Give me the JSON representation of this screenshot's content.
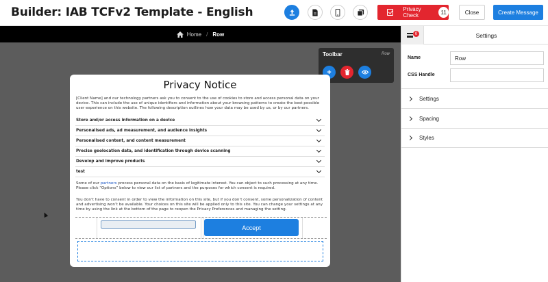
{
  "header": {
    "title": "Builder: IAB TCFv2 Template - English",
    "privacy_check_label": "Privacy Check",
    "privacy_check_count": "11",
    "close_label": "Close",
    "create_label": "Create Message"
  },
  "breadcrumb": {
    "home": "Home",
    "separator": "/",
    "current": "Row"
  },
  "toolbar": {
    "title": "Toolbar",
    "context": "Row"
  },
  "notice": {
    "title": "Privacy Notice",
    "intro": "[Client Name] and our technology partners ask you to consent to the use of cookies to store and access personal data on your device. This can include the use of unique identifiers and information about your browsing patterns to create the best possible user experience on this website. The following description outlines how your data may be used by us, or by our partners.",
    "purposes": [
      "Store and/or access information on a device",
      "Personalised ads, ad measurement, and audience insights",
      "Personalised content, and content measurement",
      "Precise geolocation data, and identification through device scanning",
      "Develop and improve products",
      "test"
    ],
    "legit_prefix": "Some of our ",
    "legit_link": "partners",
    "legit_suffix": " process personal data on the basis of legitimate interest. You can object to such processing at any time. Please click “Options” below to view our list of partners and the purposes for which consent is required.",
    "consent_text": "You don’t have to consent in order to view the information on this site, but if you don’t consent, some personalization of content and advertising won’t be available. Your choices on this site will be applied only to this site. You can change your settings at any time by using the link at the bottom of the page to reopen the Privacy Preferences and managing the setting.",
    "accept_label": "Accept"
  },
  "panel": {
    "layers_badge": "0",
    "title": "Settings",
    "name_label": "Name",
    "name_value": "Row",
    "css_label": "CSS Handle",
    "css_value": "",
    "sections": [
      "Settings",
      "Spacing",
      "Styles"
    ]
  },
  "colors": {
    "accent": "#1d7fe0",
    "danger": "#e3262f",
    "canvas": "#5c5c5c",
    "dark": "#000000"
  }
}
